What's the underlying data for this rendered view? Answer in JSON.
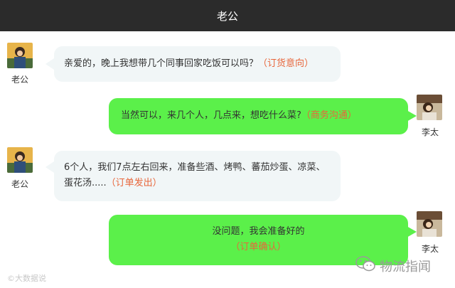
{
  "header": {
    "title": "老公"
  },
  "messages": [
    {
      "sender": "老公",
      "side": "left",
      "text": "亲爱的，晚上我想带几个同事回家吃饭可以吗？",
      "tag": "（订货意向）"
    },
    {
      "sender": "李太",
      "side": "right",
      "text": "当然可以，来几个人，几点来，想吃什么菜?",
      "tag": "（商务沟通）"
    },
    {
      "sender": "老公",
      "side": "left",
      "text_line1": "6个人，我们7点左右回来，准备些酒、烤鸭、蕃茄炒蛋、凉菜、",
      "text_line2": "蛋花汤.....",
      "tag": "（订单发出）"
    },
    {
      "sender": "李太",
      "side": "right",
      "text": "没问题，我会准备好的",
      "tag": "（订单确认）"
    }
  ],
  "watermarks": {
    "left": "©大数据说",
    "right": "物流指闻"
  },
  "colors": {
    "topbar": "#2b2b2b",
    "left_bubble": "#f1f6f7",
    "right_bubble": "#5bf04a",
    "tag": "#e8663b"
  }
}
